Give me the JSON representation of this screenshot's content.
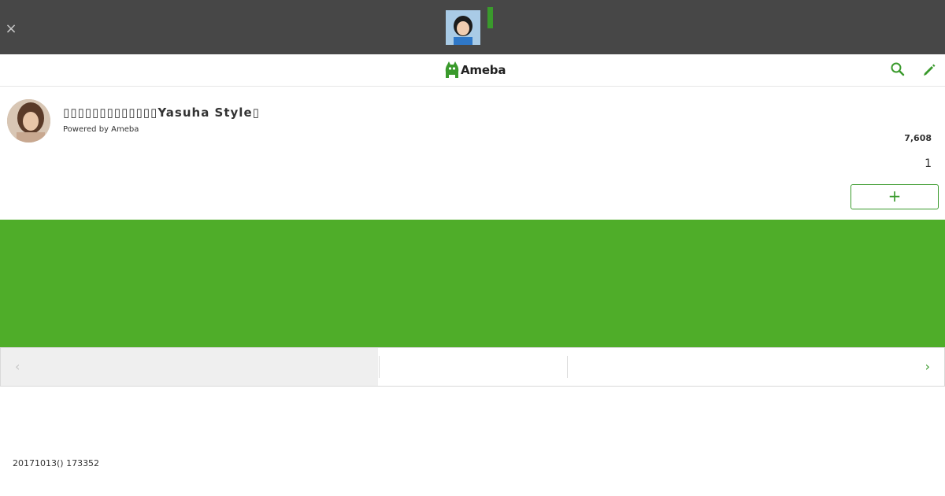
{
  "banner": {
    "close_glyph": "×"
  },
  "header": {
    "logo_text": "Ameba",
    "brand_color": "#3a9a2c",
    "search_icon": "search-icon",
    "edit_icon": "pencil-icon"
  },
  "blog": {
    "title": "Yasuha Style",
    "powered_by": "Powered by Ameba",
    "reader_count": "7,608",
    "post_count": "1",
    "follow_label": "+"
  },
  "hero": {
    "color": "#4fad29"
  },
  "nav": {
    "prev_glyph": "‹",
    "next_glyph": "›"
  },
  "entry": {
    "date": "20171013() 173352"
  }
}
